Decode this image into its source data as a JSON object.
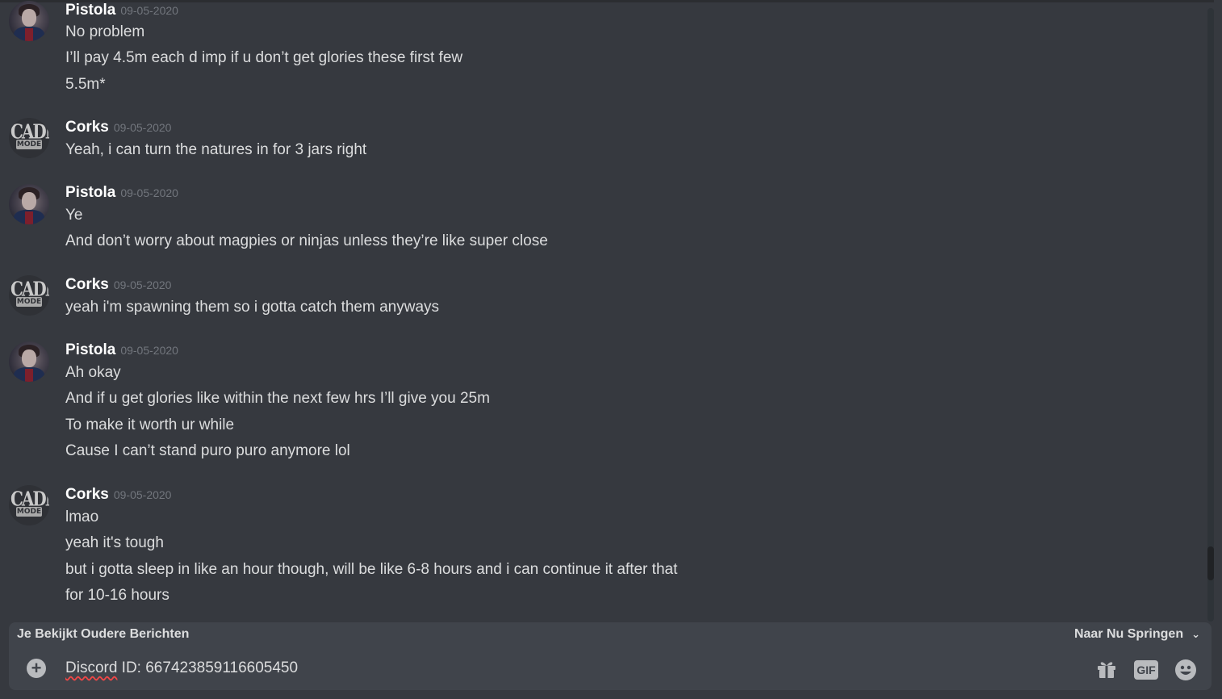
{
  "messages": [
    {
      "author": "Pistola",
      "timestamp": "09-05-2020",
      "avatar": "pistola",
      "lines": [
        "No problem",
        "I’ll pay 4.5m each d imp if u don’t get glories these first few",
        "5.5m*"
      ]
    },
    {
      "author": "Corks",
      "timestamp": "09-05-2020",
      "avatar": "corks",
      "lines": [
        "Yeah, i can turn the natures in for 3 jars right"
      ]
    },
    {
      "author": "Pistola",
      "timestamp": "09-05-2020",
      "avatar": "pistola",
      "lines": [
        "Ye",
        "And don’t worry about magpies or ninjas unless they’re like super close"
      ]
    },
    {
      "author": "Corks",
      "timestamp": "09-05-2020",
      "avatar": "corks",
      "lines": [
        "yeah i'm spawning them so i gotta catch them anyways"
      ]
    },
    {
      "author": "Pistola",
      "timestamp": "09-05-2020",
      "avatar": "pistola",
      "lines": [
        "Ah okay",
        "And if u get glories like within the next few hrs I’ll give you 25m",
        "To make it worth ur while",
        "Cause I can’t stand puro puro anymore lol"
      ]
    },
    {
      "author": "Corks",
      "timestamp": "09-05-2020",
      "avatar": "corks",
      "lines": [
        "lmao",
        "yeah it's tough",
        "but i gotta sleep in like an hour though, will be like 6-8 hours and i can continue it after that",
        "for 10-16 hours"
      ]
    }
  ],
  "avatars": {
    "corks": {
      "top": "CADMA",
      "bottom": "MODE"
    }
  },
  "older_bar": {
    "label": "Je Bekijkt Oudere Berichten",
    "jump_label": "Naar Nu Springen",
    "jump_icon": "chevron-down-icon"
  },
  "composer": {
    "value_prefix": "Discord",
    "value_rest": " ID: 667423859116605450",
    "add_icon": "plus-circle-icon",
    "gift_icon": "gift-icon",
    "gif_label": "GIF",
    "emoji_icon": "smiley-icon"
  },
  "colors": {
    "background": "#36393f",
    "input_bg": "#40444b",
    "username": "#ffffff",
    "timestamp": "#72767d",
    "text": "#dcddde",
    "spellcheck": "#f04747"
  }
}
